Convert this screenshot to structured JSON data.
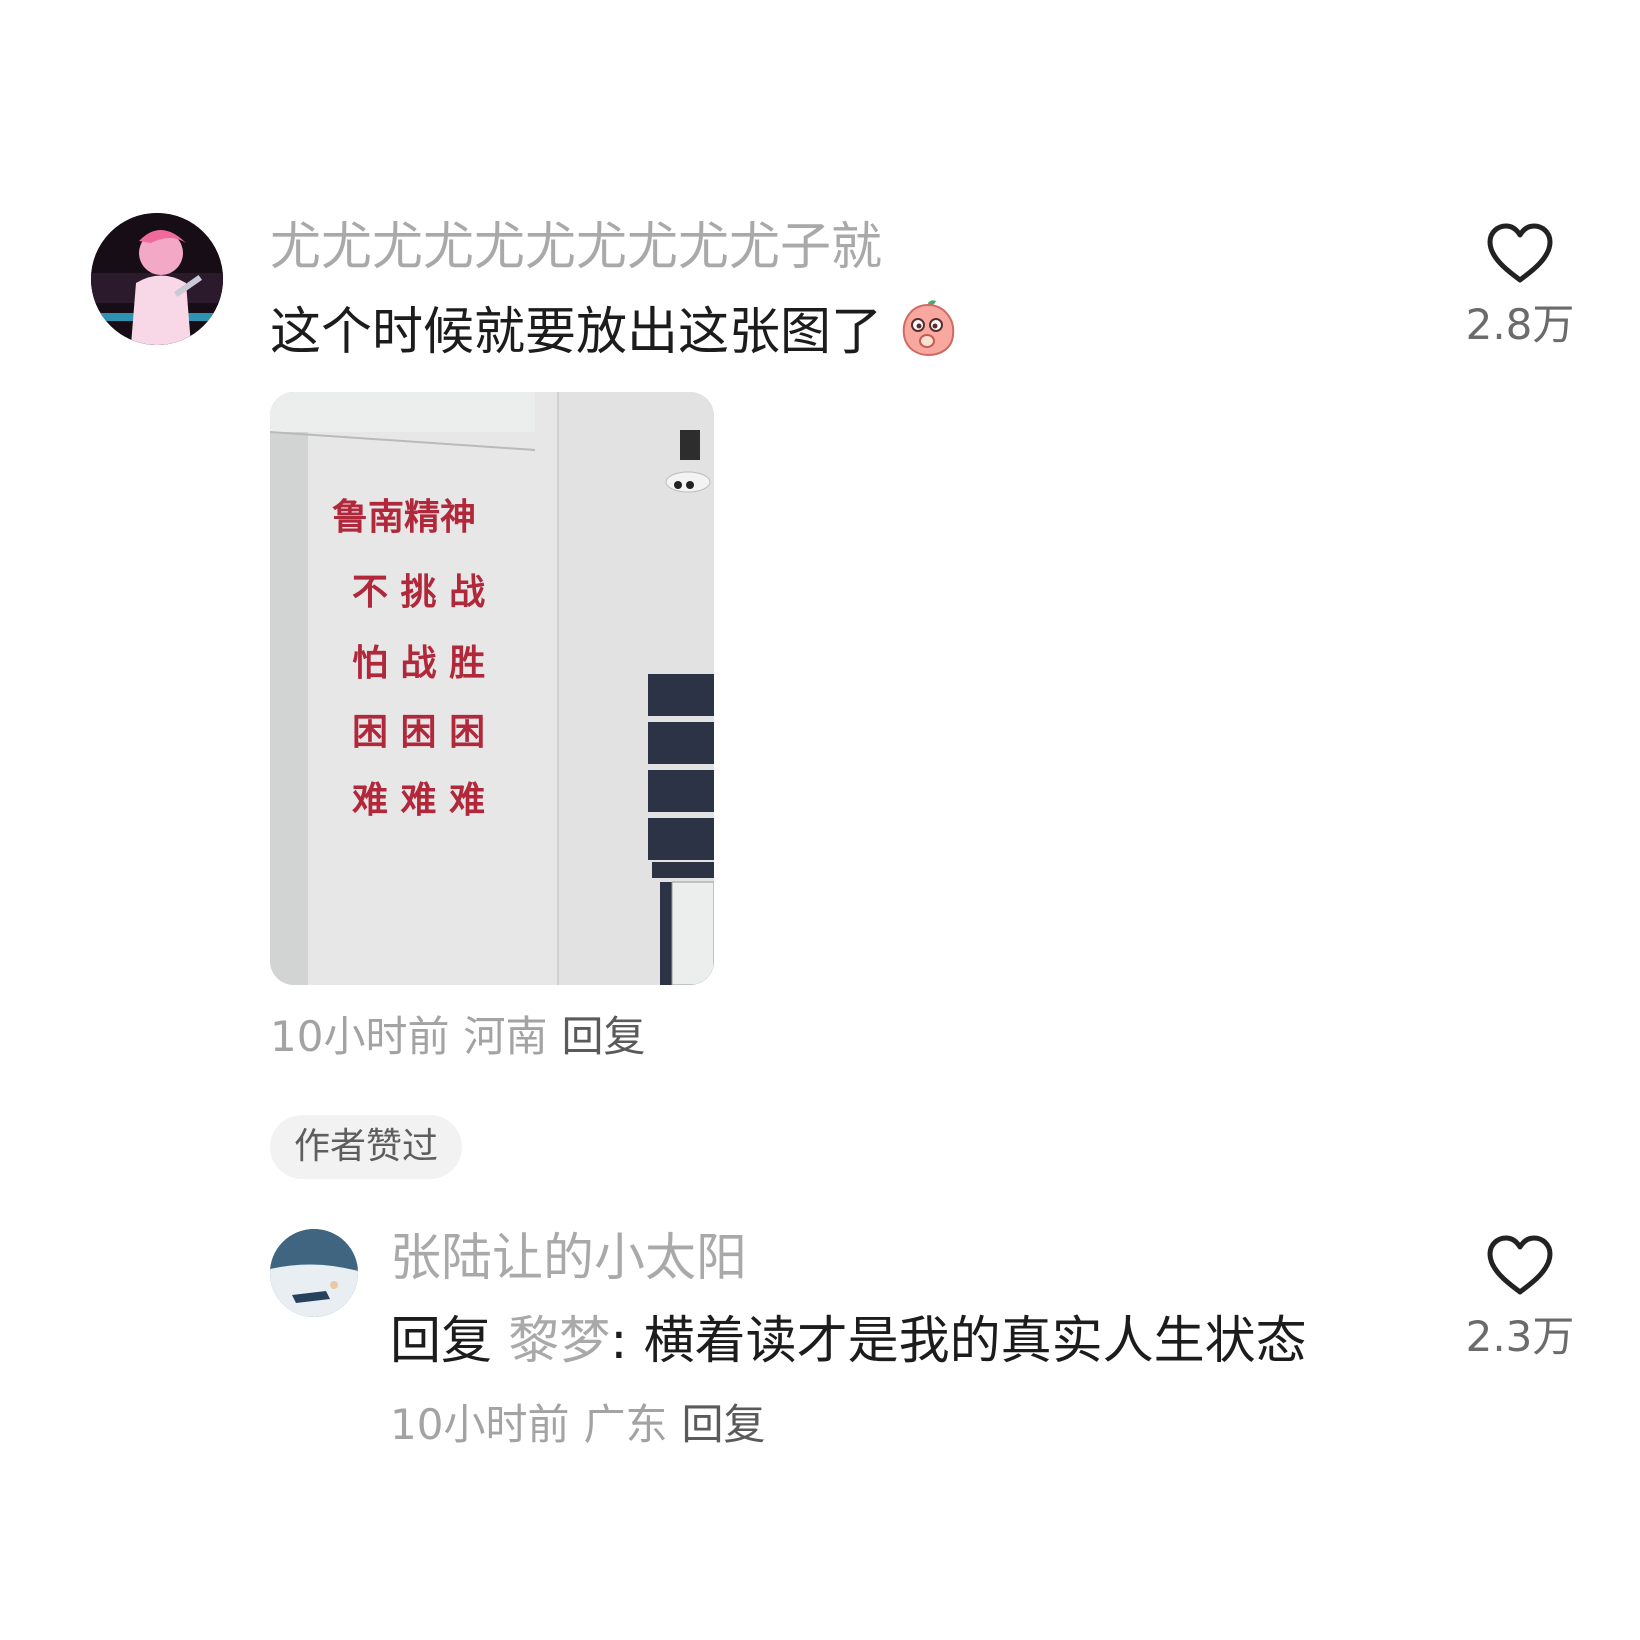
{
  "comment": {
    "username": "尤尤尤尤尤尤尤尤尤尤子就",
    "text": "这个时候就要放出这张图了",
    "emoji_icon": "peach-blush-emoji",
    "like_count": "2.8万",
    "time": "10小时前",
    "location": "河南",
    "reply_label": "回复",
    "photo_sign_lines": [
      "鲁南精神",
      "不 挑 战",
      "怕 战 胜",
      "困 困 困",
      "难 难 难"
    ]
  },
  "author_badge": "作者赞过",
  "reply": {
    "username": "张陆让的小太阳",
    "prefix": "回复",
    "target_user": "黎梦",
    "separator": ":",
    "text": "横着读才是我的真实人生状态",
    "like_count": "2.3万",
    "time": "10小时前",
    "location": "广东",
    "reply_label": "回复"
  },
  "colors": {
    "sign_red": "#b2283b",
    "heart_stroke": "#222222",
    "username_gray": "#a9a9a9"
  }
}
